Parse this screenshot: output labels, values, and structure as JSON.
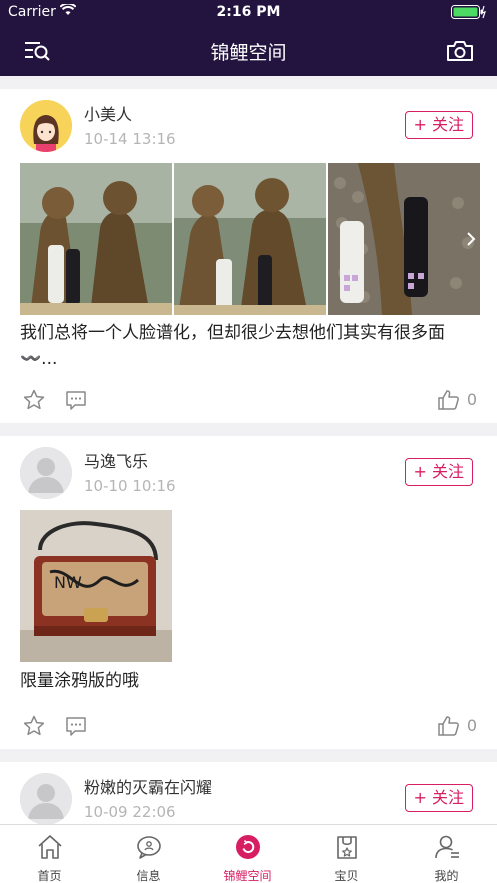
{
  "status_bar": {
    "carrier": "Carrier",
    "time": "2:16 PM"
  },
  "nav": {
    "title": "锦鲤空间"
  },
  "posts": [
    {
      "username": "小美人",
      "time": "10-14 13:16",
      "follow_label": "+ 关注",
      "text": "我们总将一个人脸谱化，但却很少去想他们其实有很多面〰️...",
      "likes": "0"
    },
    {
      "username": "马逸飞乐",
      "time": "10-10 10:16",
      "follow_label": "+ 关注",
      "text": "限量涂鸦版的哦",
      "likes": "0"
    },
    {
      "username": "粉嫩的灭霸在闪耀",
      "time": "10-09 22:06",
      "follow_label": "+ 关注"
    }
  ],
  "tabs": [
    {
      "label": "首页",
      "icon": "home-icon"
    },
    {
      "label": "信息",
      "icon": "message-icon"
    },
    {
      "label": "锦鲤空间",
      "icon": "koi-space-icon"
    },
    {
      "label": "宝贝",
      "icon": "bag-icon"
    },
    {
      "label": "我的",
      "icon": "user-icon"
    }
  ],
  "colors": {
    "header_bg": "#22133f",
    "accent": "#d81e62"
  }
}
